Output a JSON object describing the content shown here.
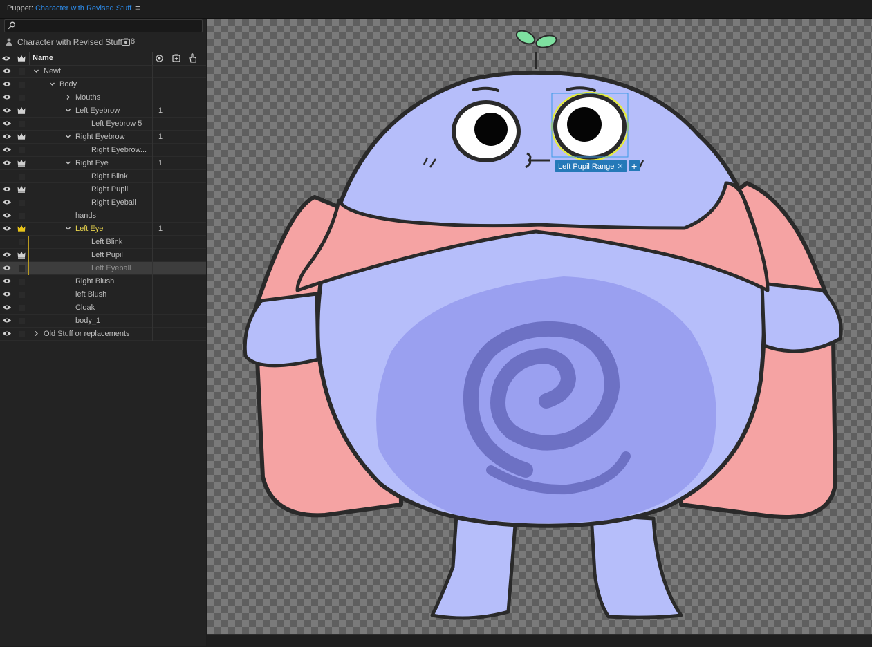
{
  "title": {
    "prefix": "Puppet: ",
    "name": "Character with Revised Stuff",
    "menu_glyph": "≡"
  },
  "puppet": {
    "name": "Character with Revised Stuff",
    "count": "8"
  },
  "columns": {
    "name": "Name"
  },
  "rows": [
    {
      "label": "Newt",
      "depth": 0,
      "chevron": "down",
      "crown": false,
      "num": "",
      "eye": true
    },
    {
      "label": "Body",
      "depth": 1,
      "chevron": "down",
      "crown": false,
      "num": "",
      "eye": true
    },
    {
      "label": "Mouths",
      "depth": 2,
      "chevron": "right",
      "crown": false,
      "num": "",
      "eye": true
    },
    {
      "label": "Left Eyebrow",
      "depth": 2,
      "chevron": "down",
      "crown": true,
      "num": "1",
      "eye": true
    },
    {
      "label": "Left Eyebrow 5",
      "depth": 3,
      "chevron": "",
      "crown": false,
      "num": "",
      "eye": true
    },
    {
      "label": "Right Eyebrow",
      "depth": 2,
      "chevron": "down",
      "crown": true,
      "num": "1",
      "eye": true
    },
    {
      "label": "Right Eyebrow...",
      "depth": 3,
      "chevron": "",
      "crown": false,
      "num": "",
      "eye": true
    },
    {
      "label": "Right Eye",
      "depth": 2,
      "chevron": "down",
      "crown": true,
      "num": "1",
      "eye": true
    },
    {
      "label": "Right Blink",
      "depth": 3,
      "chevron": "",
      "crown": false,
      "num": "",
      "eye": false
    },
    {
      "label": "Right Pupil",
      "depth": 3,
      "chevron": "",
      "crown": true,
      "num": "",
      "eye": true
    },
    {
      "label": "Right Eyeball",
      "depth": 3,
      "chevron": "",
      "crown": false,
      "num": "",
      "eye": true
    },
    {
      "label": "hands",
      "depth": 2,
      "chevron": "",
      "crown": false,
      "num": "",
      "eye": true
    },
    {
      "label": "Left Eye",
      "depth": 2,
      "chevron": "down",
      "crown": true,
      "crown_color": "#e8c41a",
      "num": "1",
      "eye": true,
      "yellow": true
    },
    {
      "label": "Left Blink",
      "depth": 3,
      "chevron": "",
      "crown": false,
      "num": "",
      "eye": false,
      "ybar": true
    },
    {
      "label": "Left Pupil",
      "depth": 3,
      "chevron": "",
      "crown": true,
      "num": "",
      "eye": true,
      "ybar": true
    },
    {
      "label": "Left Eyeball",
      "depth": 3,
      "chevron": "",
      "crown": false,
      "num": "",
      "eye": true,
      "selected": true,
      "dim": true,
      "ybar": true
    },
    {
      "label": "Right Blush",
      "depth": 2,
      "chevron": "",
      "crown": false,
      "num": "",
      "eye": true
    },
    {
      "label": "left Blush",
      "depth": 2,
      "chevron": "",
      "crown": false,
      "num": "",
      "eye": true
    },
    {
      "label": "Cloak",
      "depth": 2,
      "chevron": "",
      "crown": false,
      "num": "",
      "eye": true
    },
    {
      "label": "body_1",
      "depth": 2,
      "chevron": "",
      "crown": false,
      "num": "",
      "eye": true
    },
    {
      "label": "Old Stuff or replacements",
      "depth": 0,
      "chevron": "right",
      "crown": false,
      "num": "",
      "eye": true
    }
  ],
  "canvas": {
    "tag_label": "Left Pupil Range",
    "tag_close": "✕",
    "tag_add": "+",
    "colors": {
      "body": "#b6befa",
      "spiral_bg": "#9aa0f0",
      "spiral": "#6d71c4",
      "cloak": "#f5a3a3",
      "sprout": "#7ee0a0",
      "outline": "#2a2a2a",
      "selection": "#e6ec3a",
      "handle": "#2579b8"
    }
  },
  "colors": {
    "accent": "#2d8ceb",
    "crown_highlight": "#e8c41a"
  }
}
